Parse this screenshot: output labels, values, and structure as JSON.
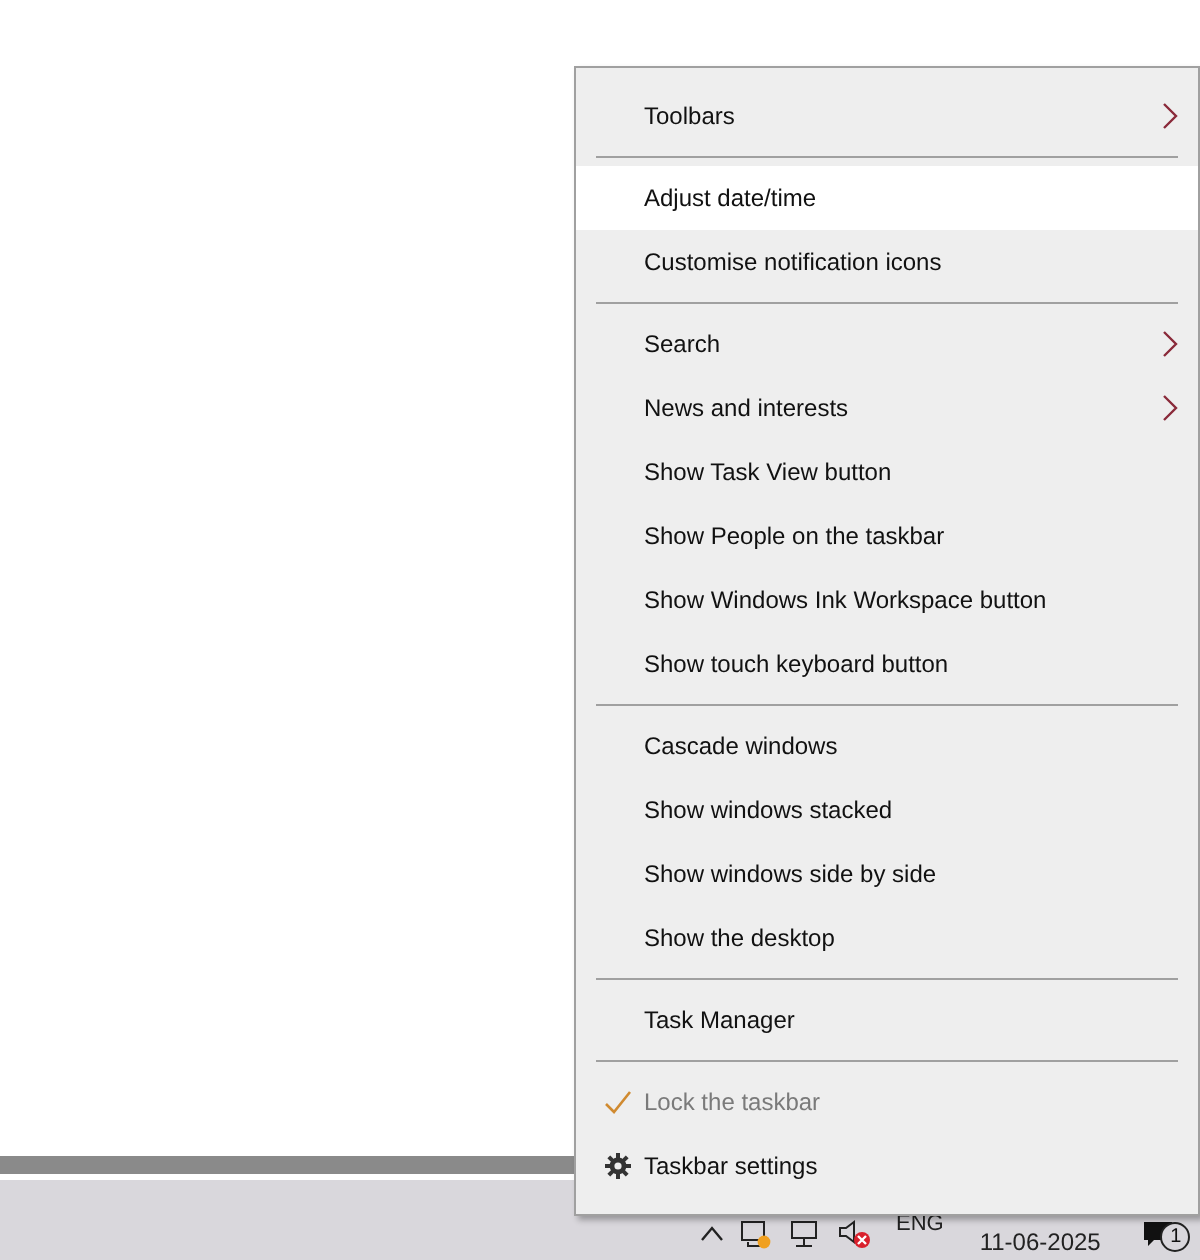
{
  "context_menu": {
    "items": [
      {
        "kind": "item",
        "label": "Toolbars",
        "submenu": true,
        "selected": false,
        "disabled": false,
        "checked": false
      },
      {
        "kind": "separator"
      },
      {
        "kind": "item",
        "label": "Adjust date/time",
        "submenu": false,
        "selected": true,
        "disabled": false,
        "checked": false
      },
      {
        "kind": "item",
        "label": "Customise notification icons",
        "submenu": false,
        "selected": false,
        "disabled": false,
        "checked": false
      },
      {
        "kind": "separator"
      },
      {
        "kind": "item",
        "label": "Search",
        "submenu": true,
        "selected": false,
        "disabled": false,
        "checked": false
      },
      {
        "kind": "item",
        "label": "News and interests",
        "submenu": true,
        "selected": false,
        "disabled": false,
        "checked": false
      },
      {
        "kind": "item",
        "label": "Show Task View button",
        "submenu": false,
        "selected": false,
        "disabled": false,
        "checked": false
      },
      {
        "kind": "item",
        "label": "Show People on the taskbar",
        "submenu": false,
        "selected": false,
        "disabled": false,
        "checked": false
      },
      {
        "kind": "item",
        "label": "Show Windows Ink Workspace button",
        "submenu": false,
        "selected": false,
        "disabled": false,
        "checked": false
      },
      {
        "kind": "item",
        "label": "Show touch keyboard button",
        "submenu": false,
        "selected": false,
        "disabled": false,
        "checked": false
      },
      {
        "kind": "separator"
      },
      {
        "kind": "item",
        "label": "Cascade windows",
        "submenu": false,
        "selected": false,
        "disabled": false,
        "checked": false
      },
      {
        "kind": "item",
        "label": "Show windows stacked",
        "submenu": false,
        "selected": false,
        "disabled": false,
        "checked": false
      },
      {
        "kind": "item",
        "label": "Show windows side by side",
        "submenu": false,
        "selected": false,
        "disabled": false,
        "checked": false
      },
      {
        "kind": "item",
        "label": "Show the desktop",
        "submenu": false,
        "selected": false,
        "disabled": false,
        "checked": false
      },
      {
        "kind": "separator"
      },
      {
        "kind": "item",
        "label": "Task Manager",
        "submenu": false,
        "selected": false,
        "disabled": false,
        "checked": false
      },
      {
        "kind": "separator"
      },
      {
        "kind": "item",
        "label": "Lock the taskbar",
        "submenu": false,
        "selected": false,
        "disabled": true,
        "checked": true
      },
      {
        "kind": "settings",
        "label": "Taskbar settings",
        "submenu": false,
        "selected": false,
        "disabled": false,
        "checked": false
      }
    ]
  },
  "taskbar": {
    "language": "ENG",
    "date": "11-06-2025",
    "notification_count": "1"
  }
}
